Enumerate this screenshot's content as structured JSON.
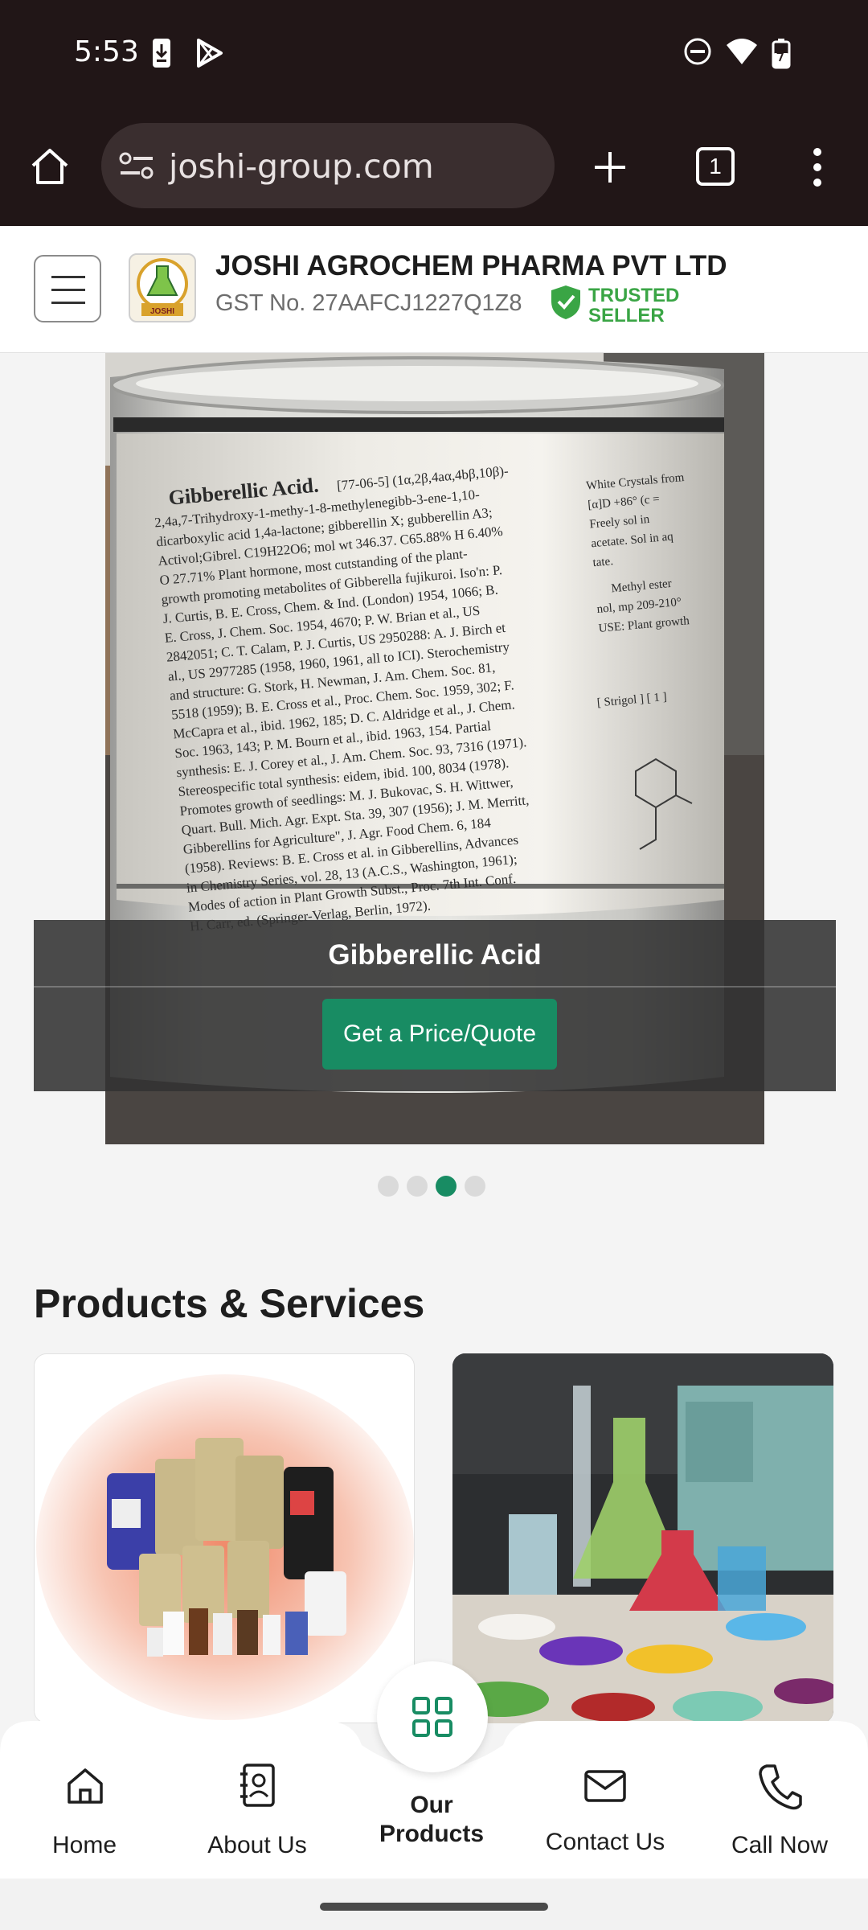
{
  "status_bar": {
    "time": "5:53",
    "left_icons": [
      "download-icon",
      "play-store-icon"
    ],
    "right_icons": [
      "dnd-icon",
      "wifi-icon",
      "battery-icon"
    ]
  },
  "browser": {
    "url": "joshi-group.com",
    "tab_count": "1",
    "icons": [
      "home-icon",
      "site-settings-icon",
      "new-tab-icon",
      "tab-switcher-icon",
      "more-icon"
    ]
  },
  "site_header": {
    "company_name": "JOSHI AGROCHEM PHARMA PVT LTD",
    "gst": "GST No. 27AAFCJ1227Q1Z8",
    "trusted_line1": "TRUSTED",
    "trusted_line2": "SELLER",
    "logo_text": "JOSHI"
  },
  "hero": {
    "product_title": "Gibberellic Acid",
    "cta_label": "Get a Price/Quote",
    "slide_count": 4,
    "active_slide": 3,
    "label_text": {
      "heading": "Gibberellic Acid.",
      "lines": [
        "[77-06-5] (1α,2β,4aα,4bβ,10β)-",
        "2,4a,7-Trihydroxy-1-methy-1-8-methylenegibb-3-ene-1,10-",
        "dicarboxylic acid 1,4a-lactone; gibberellin X; gubberellin A3;",
        "Activol;Gibrel. C19H22O6; mol wt 346.37. C65.88% H 6.40%",
        "O 27.71% Plant hormone, most cutstanding of the plant-",
        "growth promoting metabolites of Gibberella fujikuroi. Iso'n: P.",
        "J. Curtis, B. E. Cross, Chem. & Ind. (London) 1954, 1066; B.",
        "E. Cross, J. Chem. Soc. 1954, 4670; P. W. Brian et al., US",
        "2842051; C. T. Calam, P. J. Curtis, US 2950288: A. J. Birch et",
        "al., US 2977285 (1958, 1960, 1961, all to ICI). Sterochemistry",
        "and structure: G. Stork, H. Newman, J. Am. Chem. Soc. 81,",
        "5518 (1959); B. E. Cross et al., Proc. Chem. Soc. 1959, 302; F.",
        "McCapra et al., ibid. 1962, 185; D. C. Aldridge et al., J. Chem.",
        "Soc. 1963, 143; P. M. Bourn et al., ibid. 1963, 154. Partial",
        "synthesis: E. J. Corey et al., J. Am. Chem. Soc. 93, 7316 (1971).",
        "Stereospecific total synthesis: eidem, ibid. 100, 8034 (1978).",
        "Promotes growth of seedlings: M. J. Bukovac, S. H. Wittwer,",
        "Quart. Bull. Mich. Agr. Expt. Sta. 39, 307 (1956); J. M. Merritt,",
        "Gibberellins for Agriculture\", J. Agr. Food Chem. 6, 184",
        "(1958). Reviews: B. E. Cross et al. in Gibberellins, Advances",
        "in Chemistry Series, vol. 28, 13 (A.C.S., Washington, 1961);",
        "Modes of action in Plant Growth Subst., Proc. 7th Int. Conf.",
        "H. Carr, ed. (Springer-Verlag, Berlin, 1972)."
      ],
      "right_fragments": [
        "White Crystals from",
        "[α]D +86° (c =",
        "Freely sol in",
        "acetate. Sol in aq",
        "tate.",
        "Methyl ester",
        "nol, mp 209-210°",
        "USE: Plant growth",
        "[ Strigol ] [ 1 ]"
      ]
    }
  },
  "products_section": {
    "title": "Products & Services",
    "cards": [
      {
        "name": "product-card-chemicals"
      },
      {
        "name": "product-card-lab-glassware"
      }
    ]
  },
  "bottom_nav": {
    "items": [
      {
        "label": "Home",
        "icon": "home-icon"
      },
      {
        "label": "About Us",
        "icon": "contacts-book-icon"
      },
      {
        "label_line1": "Our",
        "label_line2": "Products",
        "icon": "grid-icon"
      },
      {
        "label": "Contact Us",
        "icon": "mail-icon"
      },
      {
        "label": "Call Now",
        "icon": "phone-icon"
      }
    ]
  },
  "colors": {
    "accent": "#188c63",
    "status_bar_bg": "#211617",
    "trusted_green": "#3aa545"
  }
}
